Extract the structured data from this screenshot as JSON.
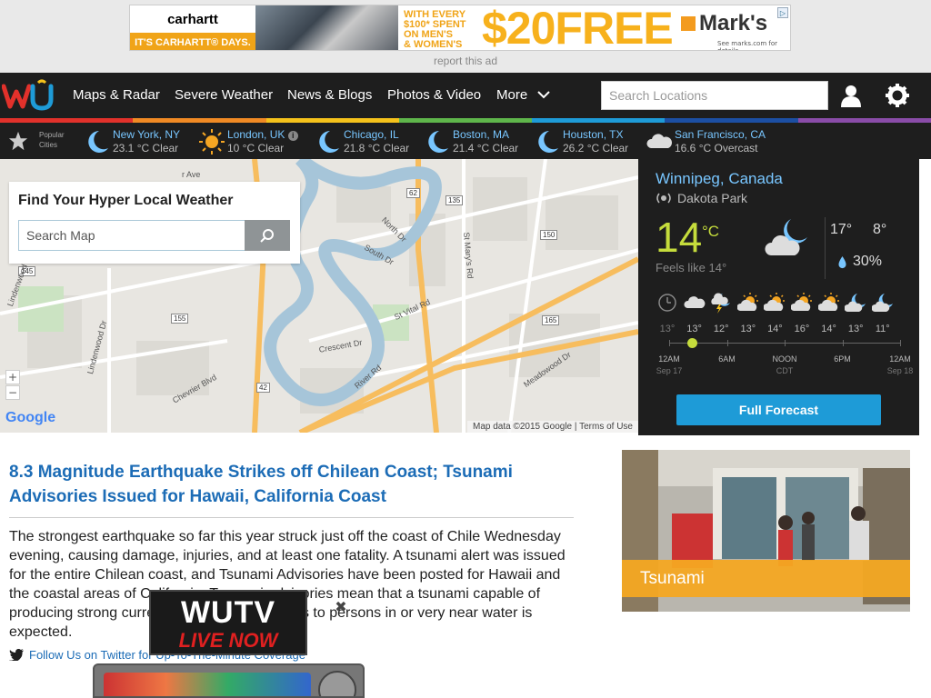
{
  "ad": {
    "brand": "carhartt",
    "tagline": "IT'S CARHARTT® DAYS.",
    "offer_lines": [
      "WITH EVERY",
      "$100* SPENT",
      "ON MEN'S",
      "& WOMEN'S"
    ],
    "big_text": "$20FREE",
    "advertiser": "Mark's",
    "fine_print": "See marks.com for details",
    "report_link": "report this ad"
  },
  "nav": {
    "items": [
      "Maps & Radar",
      "Severe Weather",
      "News & Blogs",
      "Photos & Video",
      "More"
    ],
    "search_placeholder": "Search Locations"
  },
  "colors": {
    "brand_strip": [
      "#e2312b",
      "#f08a24",
      "#f5c21b",
      "#5fb64b",
      "#1e9bd7",
      "#1c4fa3",
      "#8a4ca8"
    ],
    "link_blue": "#1c6cb6",
    "accent_lime": "#c5dc3c",
    "button_blue": "#1e9bd7",
    "tsunami_orange": "#f4a822"
  },
  "popular_cities": {
    "label_line1": "Popular",
    "label_line2": "Cities",
    "cities": [
      {
        "name": "New York, NY",
        "cond": "23.1 °C Clear",
        "icon": "moon-icon"
      },
      {
        "name": "London, UK",
        "cond": "10 °C Clear",
        "icon": "sun-icon"
      },
      {
        "name": "Chicago, IL",
        "cond": "21.8 °C Clear",
        "icon": "moon-icon"
      },
      {
        "name": "Boston, MA",
        "cond": "21.4 °C Clear",
        "icon": "moon-icon"
      },
      {
        "name": "Houston, TX",
        "cond": "26.2 °C Clear",
        "icon": "moon-icon"
      },
      {
        "name": "San Francisco, CA",
        "cond": "16.6 °C Overcast",
        "icon": "cloud-icon"
      }
    ]
  },
  "map": {
    "widget_title": "Find Your Hyper Local Weather",
    "search_placeholder": "Search Map",
    "zoom_in": "+",
    "zoom_out": "−",
    "google": "Google",
    "attribution": "Map data ©2015 Google",
    "terms": "Terms of Use",
    "shields": [
      "62",
      "135",
      "145",
      "155",
      "42",
      "150",
      "165"
    ],
    "streets": [
      "Lindenwood Dr W",
      "Lindenwood Dr",
      "Chevrier Blvd",
      "North Dr",
      "South Dr",
      "St Mary's Rd",
      "St Vital Rd",
      "Crescent Dr",
      "River Rd",
      "Meadowood Dr",
      "r Ave"
    ]
  },
  "weather": {
    "city": "Winnipeg, Canada",
    "station": "Dakota Park",
    "temp": "14",
    "unit": "°C",
    "feels_like": "Feels like 14°",
    "high": "17°",
    "low": "8°",
    "precip": "30%",
    "hourly": [
      {
        "icon": "clock-icon",
        "temp": "13°"
      },
      {
        "icon": "cloud-icon",
        "temp": "13°"
      },
      {
        "icon": "thunderstorm-icon",
        "temp": "12°"
      },
      {
        "icon": "partly-cloudy-icon",
        "temp": "13°"
      },
      {
        "icon": "partly-cloudy-icon",
        "temp": "14°"
      },
      {
        "icon": "partly-cloudy-icon",
        "temp": "16°"
      },
      {
        "icon": "partly-cloudy-icon",
        "temp": "14°"
      },
      {
        "icon": "moon-cloud-icon",
        "temp": "13°"
      },
      {
        "icon": "moon-cloud-icon",
        "temp": "11°"
      }
    ],
    "timeline": [
      {
        "label": "12AM",
        "sub": "Sep 17"
      },
      {
        "label": "6AM",
        "sub": ""
      },
      {
        "label": "NOON",
        "sub": "CDT"
      },
      {
        "label": "6PM",
        "sub": ""
      },
      {
        "label": "12AM",
        "sub": "Sep 18"
      }
    ],
    "forecast_button": "Full Forecast"
  },
  "article": {
    "title": "8.3 Magnitude Earthquake Strikes off Chilean Coast; Tsunami Advisories Issued for Hawaii, California Coast",
    "body": "The strongest earthquake so far this year struck just off the coast of Chile Wednesday evening, causing damage, injuries, and at least one fatality. A tsunami alert was issued for the entire Chilean coast, and Tsunami Advisories have been posted for Hawaii and the coastal areas of California. Tsunami advisories mean that a tsunami capable of producing strong currents or waves dangerous to persons in or very near water is expected.",
    "follow": "Follow Us on Twitter for Up-To-The-Minute Coverage"
  },
  "tsunami_card": {
    "label": "Tsunami"
  },
  "wutv": {
    "title": "WUTV",
    "live": "LIVE NOW",
    "close": "✖"
  }
}
